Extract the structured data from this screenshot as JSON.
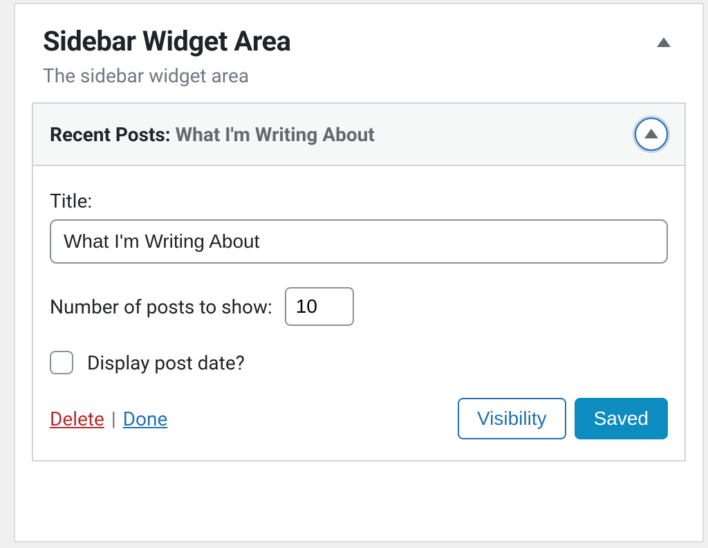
{
  "panel": {
    "title": "Sidebar Widget Area",
    "description": "The sidebar widget area"
  },
  "widget": {
    "type_label": "Recent Posts:",
    "instance_title": "What I'm Writing About",
    "fields": {
      "title_label": "Title:",
      "title_value": "What I'm Writing About",
      "number_label": "Number of posts to show:",
      "number_value": "10",
      "display_date_label": "Display post date?",
      "display_date_checked": false
    },
    "actions": {
      "delete": "Delete",
      "separator": "|",
      "done": "Done",
      "visibility": "Visibility",
      "saved": "Saved"
    }
  }
}
